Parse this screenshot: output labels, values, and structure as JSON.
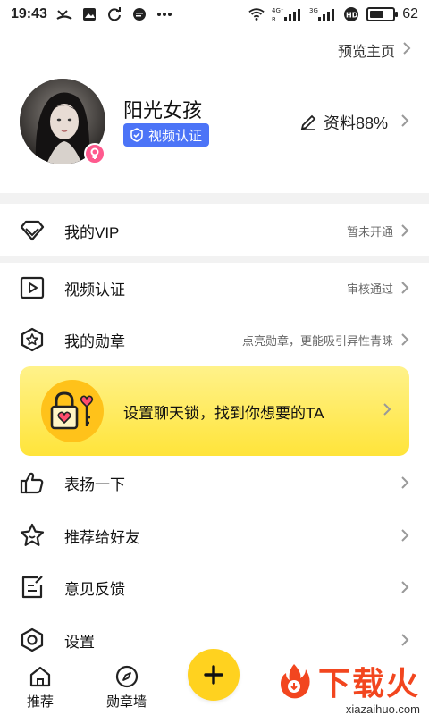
{
  "status_bar": {
    "time": "19:43",
    "network_labels": [
      "4G⁺",
      "R",
      "3G"
    ],
    "battery_text": "62",
    "battery_level": 0.62
  },
  "header": {
    "preview_label": "预览主页"
  },
  "profile": {
    "name": "阳光女孩",
    "badge": "视频认证",
    "edit_label": "资料88%"
  },
  "rows": {
    "vip": {
      "label": "我的VIP",
      "hint": "暂未开通"
    },
    "video": {
      "label": "视频认证",
      "hint": "审核通过"
    },
    "medal": {
      "label": "我的勋章",
      "hint": "点亮勋章，更能吸引异性青睐"
    },
    "praise": {
      "label": "表扬一下"
    },
    "recommend": {
      "label": "推荐给好友"
    },
    "feedback": {
      "label": "意见反馈"
    },
    "settings": {
      "label": "设置"
    }
  },
  "banner": {
    "text": "设置聊天锁，找到你想要的TA"
  },
  "bottom_nav": {
    "items": [
      {
        "label": "推荐",
        "icon": "home-icon"
      },
      {
        "label": "勋章墙",
        "icon": "compass-icon"
      }
    ],
    "fab_icon": "plus-icon"
  },
  "watermark": {
    "title": "下载火",
    "url": "xiazaihuo.com"
  },
  "colors": {
    "accent_yellow": "#ffd21f",
    "badge_blue": "#4c74f7",
    "gender_pink": "#ff5a8e",
    "watermark_red": "#f2461f"
  }
}
